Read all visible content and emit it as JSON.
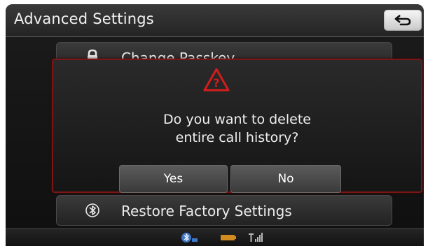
{
  "header": {
    "title": "Advanced Settings",
    "back_icon": "back-arrow-icon"
  },
  "menu": {
    "items": [
      {
        "label": "Change Passkey",
        "icon": "lock-icon"
      },
      {
        "label": "Restore Factory Settings",
        "icon": "bluetooth-restore-icon"
      }
    ]
  },
  "dialog": {
    "warning_icon": "warning-question-icon",
    "message_line1": "Do you want to delete",
    "message_line2": "entire call history?",
    "yes_label": "Yes",
    "no_label": "No"
  },
  "status_bar": {
    "icons": [
      "bluetooth-status-icon",
      "battery-icon",
      "signal-icon"
    ]
  },
  "colors": {
    "dialog_border": "#7a1616",
    "warning": "#d11d1d",
    "text": "#f0f0f0"
  }
}
